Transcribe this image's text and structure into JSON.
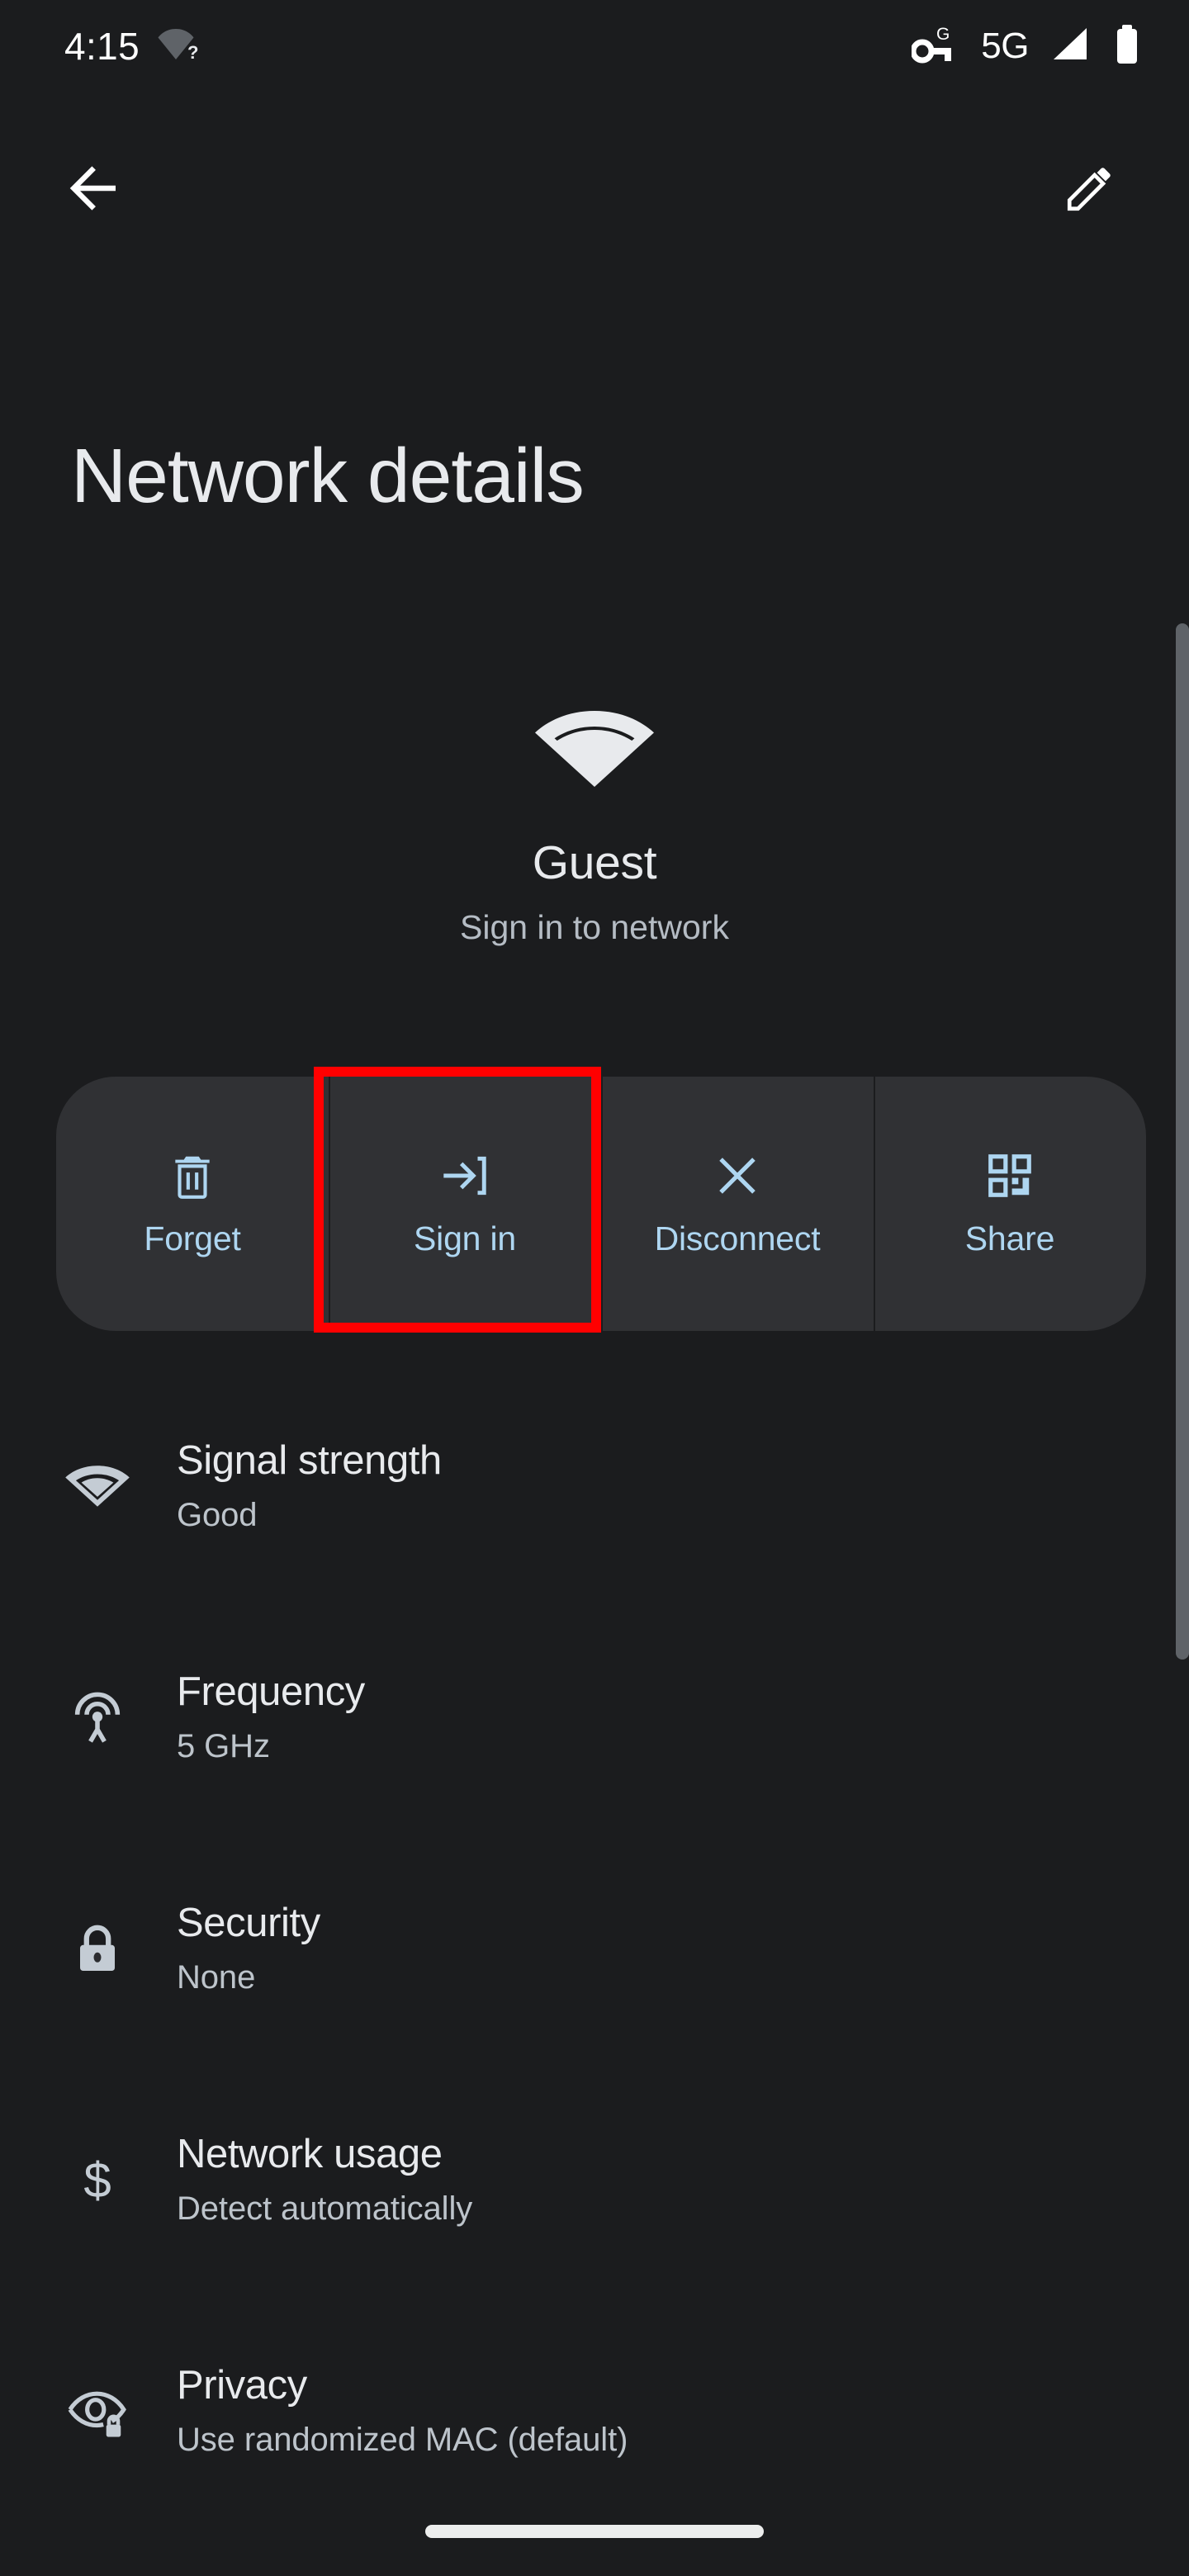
{
  "status_bar": {
    "time": "4:15",
    "wifi_no_internet_icon": "wifi-question-icon",
    "vpn_icon": "vpn-key-g-icon",
    "network_type": "5G",
    "signal_icon": "cell-signal-icon",
    "battery_icon": "battery-full-icon"
  },
  "app_bar": {
    "back_icon": "back-arrow-icon",
    "edit_icon": "pencil-edit-icon"
  },
  "page": {
    "title": "Network details"
  },
  "network": {
    "wifi_icon": "wifi-signal-icon",
    "ssid": "Guest",
    "status": "Sign in to network"
  },
  "actions": [
    {
      "label": "Forget",
      "icon": "trash-icon",
      "highlighted": false
    },
    {
      "label": "Sign in",
      "icon": "login-icon",
      "highlighted": true
    },
    {
      "label": "Disconnect",
      "icon": "close-x-icon",
      "highlighted": false
    },
    {
      "label": "Share",
      "icon": "qr-code-icon",
      "highlighted": false
    }
  ],
  "details": [
    {
      "title": "Signal strength",
      "value": "Good",
      "icon": "wifi-signal-icon"
    },
    {
      "title": "Frequency",
      "value": "5 GHz",
      "icon": "broadcast-antenna-icon"
    },
    {
      "title": "Security",
      "value": "None",
      "icon": "lock-icon"
    },
    {
      "title": "Network usage",
      "value": "Detect automatically",
      "icon": "dollar-sign-icon"
    },
    {
      "title": "Privacy",
      "value": "Use randomized MAC (default)",
      "icon": "eye-lock-icon"
    }
  ],
  "colors": {
    "background": "#1b1c1e",
    "surface": "#303134",
    "accent_blue": "#aed6f1",
    "highlight_red": "#ff0000",
    "text_primary": "#e8eaed",
    "text_secondary": "#bdc4cb"
  },
  "nav": {
    "gesture_pill": "gesture-nav-pill"
  }
}
